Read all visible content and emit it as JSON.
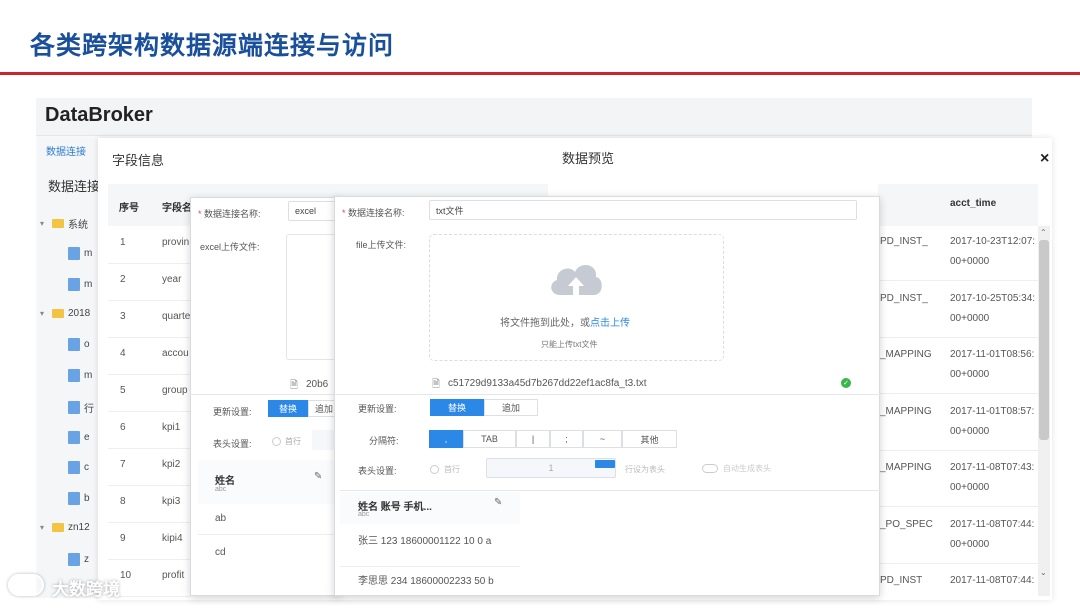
{
  "slide": {
    "title": "各类跨架构数据源端连接与访问"
  },
  "app": {
    "brand": "DataBroker",
    "side_tab": "数据连接",
    "side_heading": "数据连接"
  },
  "tree": [
    {
      "label": "系统",
      "type": "folder",
      "expanded": true
    },
    {
      "label": "m",
      "type": "file"
    },
    {
      "label": "m",
      "type": "file"
    },
    {
      "label": "2018",
      "type": "folder",
      "expanded": true
    },
    {
      "label": "o",
      "type": "file"
    },
    {
      "label": "m",
      "type": "file"
    },
    {
      "label": "行",
      "type": "file"
    },
    {
      "label": "e",
      "type": "file"
    },
    {
      "label": "c",
      "type": "file"
    },
    {
      "label": "b",
      "type": "file"
    },
    {
      "label": "zn12",
      "type": "folder",
      "expanded": true
    },
    {
      "label": "z",
      "type": "file"
    }
  ],
  "field_panel": {
    "title": "字段信息",
    "headers": [
      "序号",
      "字段名"
    ],
    "rows": [
      {
        "no": "1",
        "name": "provin"
      },
      {
        "no": "2",
        "name": "year"
      },
      {
        "no": "3",
        "name": "quarte"
      },
      {
        "no": "4",
        "name": "accou"
      },
      {
        "no": "5",
        "name": "group"
      },
      {
        "no": "6",
        "name": "kpi1"
      },
      {
        "no": "7",
        "name": "kpi2"
      },
      {
        "no": "8",
        "name": "kpi3"
      },
      {
        "no": "9",
        "name": "kipi4"
      },
      {
        "no": "10",
        "name": "profit"
      }
    ]
  },
  "preview_panel": {
    "title": "数据预览",
    "close_glyph": "×",
    "header": "acct_time",
    "rows": [
      {
        "mid": "PD_INST_",
        "time": "2017-10-23T12:07:",
        "tz": "00+0000"
      },
      {
        "mid": "PD_INST_",
        "time": "2017-10-25T05:34:",
        "tz": "00+0000"
      },
      {
        "mid": "_MAPPING",
        "time": "2017-11-01T08:56:",
        "tz": "00+0000"
      },
      {
        "mid": "_MAPPING",
        "time": "2017-11-01T08:57:",
        "tz": "00+0000"
      },
      {
        "mid": "_MAPPING",
        "time": "2017-11-08T07:43:",
        "tz": "00+0000"
      },
      {
        "mid": "_PO_SPEC",
        "time": "2017-11-08T07:44:",
        "tz": "00+0000"
      },
      {
        "mid": "PD_INST",
        "time": "2017-11-08T07:44:",
        "tz": ""
      }
    ]
  },
  "excel_dialog": {
    "name_label": "数据连接名称:",
    "name_value": "excel",
    "upload_label": "excel上传文件:",
    "file_name": "20b6",
    "update_label": "更新设置:",
    "update_options": [
      "替换",
      "追加"
    ],
    "header_label": "表头设置:",
    "header_option": "首行",
    "col_header": "姓名",
    "col_type": "abc",
    "data_rows": [
      "ab",
      "cd"
    ]
  },
  "txt_dialog": {
    "name_label": "数据连接名称:",
    "name_value": "txt文件",
    "upload_label": "file上传文件:",
    "drop_text": "将文件拖到此处，或",
    "drop_link": "点击上传",
    "hint": "只能上传txt文件",
    "file_name": "c51729d9133a45d7b267dd22ef1ac8fa_t3.txt",
    "update_label": "更新设置:",
    "update_options": [
      "替换",
      "追加"
    ],
    "sep_label": "分隔符:",
    "sep_options": [
      ",",
      "TAB",
      "|",
      ";",
      "~",
      "其他"
    ],
    "header_label": "表头设置:",
    "header_first": "首行",
    "header_row_value": "1",
    "header_row_suffix": "行设为表头",
    "auto_header": "自动生成表头",
    "col_header": "姓名 账号 手机...",
    "col_type": "abc",
    "data_rows": [
      "张三 123 18600001122 10 0 a",
      "李思思 234 18600002233 50 b"
    ]
  },
  "watermark": {
    "text": "大数跨境"
  },
  "colors": {
    "accent": "#2b88e6",
    "title_blue": "#1a4f9c",
    "rule_red": "#c8252c",
    "success": "#3bb54a"
  }
}
